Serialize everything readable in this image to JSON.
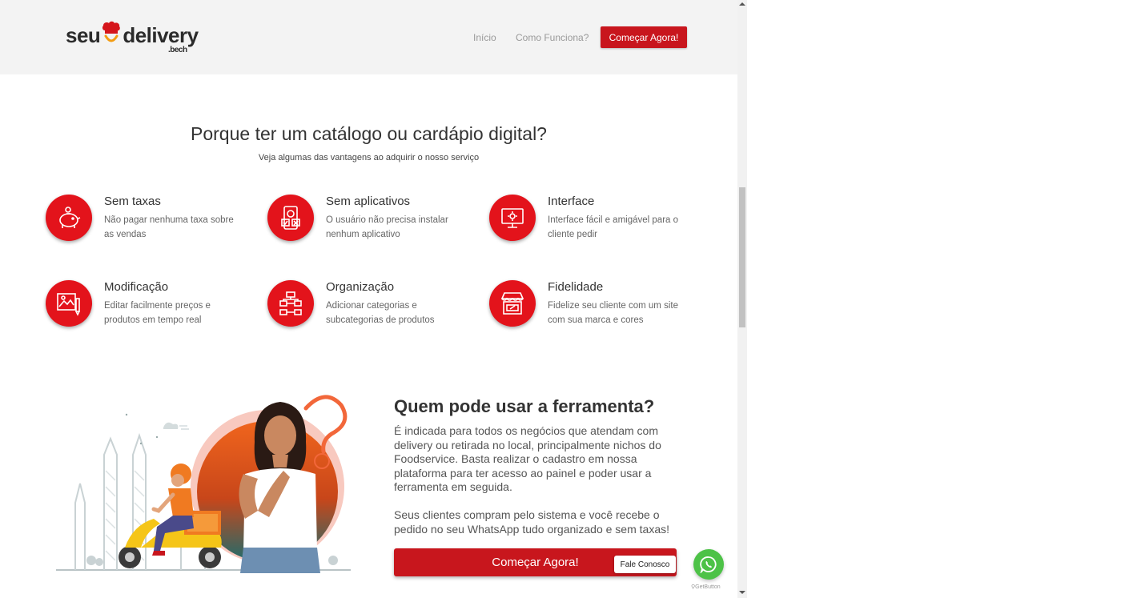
{
  "header": {
    "logo": {
      "part1": "seu",
      "part2": "delivery",
      "suffix": ".bech"
    },
    "nav": {
      "inicio": "Início",
      "como_funciona": "Como Funciona?"
    },
    "cta_label": "Começar Agora!"
  },
  "intro": {
    "title": "Porque ter um catálogo ou cardápio digital?",
    "subtitle": "Veja algumas das vantagens ao adquirir o nosso serviço"
  },
  "features": [
    {
      "title": "Sem taxas",
      "desc": "Não pagar nenhuma taxa sobre as vendas",
      "icon": "piggy-bank-icon"
    },
    {
      "title": "Sem aplicativos",
      "desc": "O usuário não precisa instalar nenhum aplicativo",
      "icon": "smartphone-icon"
    },
    {
      "title": "Interface",
      "desc": "Interface fácil e amigável para o cliente pedir",
      "icon": "monitor-gear-icon"
    },
    {
      "title": "Modificação",
      "desc": "Editar facilmente preços e produtos em tempo real",
      "icon": "image-edit-icon"
    },
    {
      "title": "Organização",
      "desc": "Adicionar categorias e subcategorias de produtos",
      "icon": "hierarchy-icon"
    },
    {
      "title": "Fidelidade",
      "desc": "Fidelize seu cliente com um site com sua marca e cores",
      "icon": "storefront-icon"
    }
  ],
  "who": {
    "title_prefix": "Quem pode usar a ",
    "title_bold": "ferramenta?",
    "paragraph1": "É indicada para todos os negócios que atendam com delivery ou retirada no local, principalmente nichos do Foodservice. Basta realizar o cadastro em nossa plataforma para ter acesso ao painel e poder usar a ferramenta em seguida.",
    "paragraph2": "Seus clientes compram pelo sistema e você recebe o pedido no seu WhatsApp tudo organizado e sem taxas!",
    "cta_label": "Começar Agora!"
  },
  "whatsapp": {
    "tooltip": "Fale Conosco",
    "credit": "GetButton"
  },
  "colors": {
    "brand_red": "#c8161d",
    "icon_red": "#e3131b",
    "whatsapp_green": "#4dc247"
  }
}
